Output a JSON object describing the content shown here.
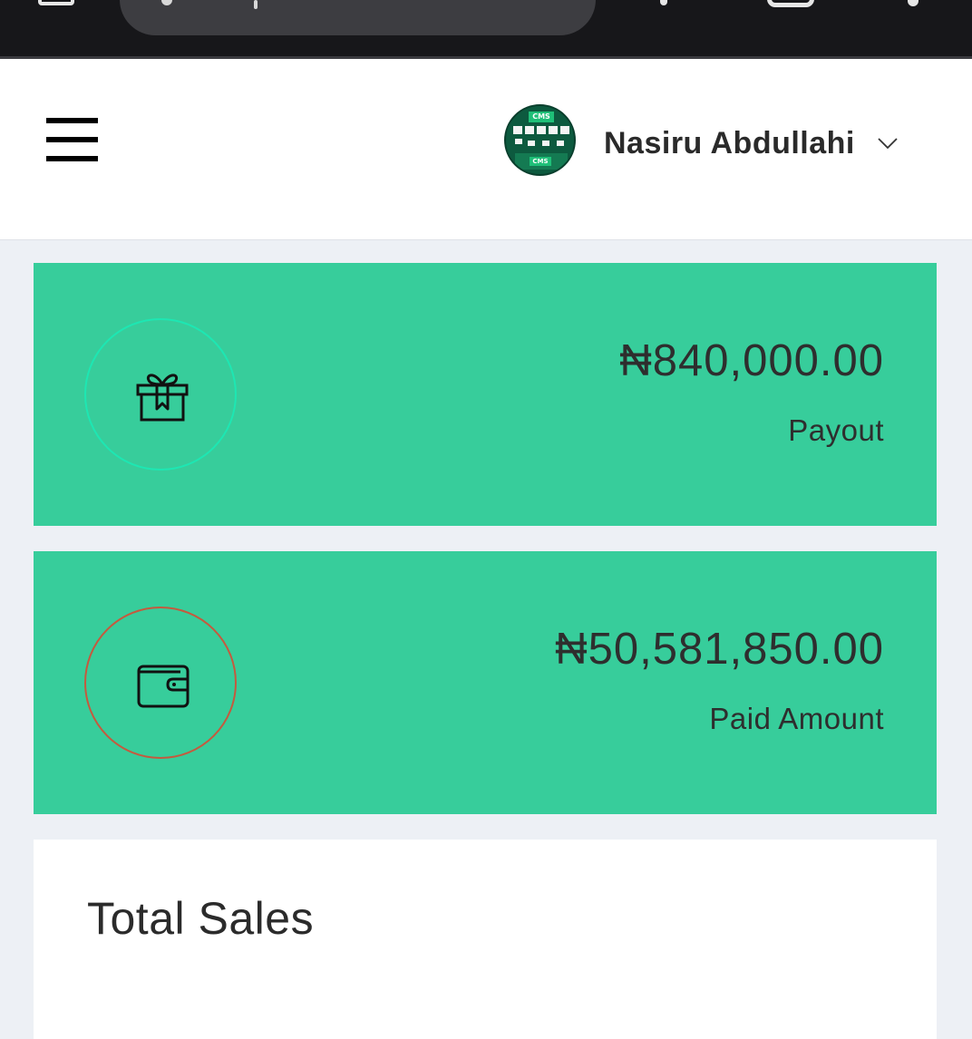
{
  "header": {
    "user_name": "Nasiru Abdullahi",
    "avatar_logo": "CMS"
  },
  "stats": [
    {
      "amount": "₦840,000.00",
      "label": "Payout",
      "icon": "gift-icon",
      "ring_color": "#1de7b3"
    },
    {
      "amount": "₦50,581,850.00",
      "label": "Paid Amount",
      "icon": "wallet-icon",
      "ring_color": "#c55a3e"
    }
  ],
  "sales": {
    "title": "Total Sales"
  },
  "colors": {
    "card_background": "#37cd9b",
    "page_background": "#edf0f5",
    "browser_bar": "#17171a"
  }
}
